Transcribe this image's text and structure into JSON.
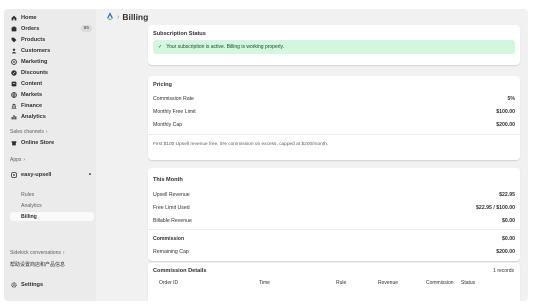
{
  "sidebar": {
    "items": [
      {
        "label": "Home",
        "icon": "home-icon"
      },
      {
        "label": "Orders",
        "icon": "orders-icon",
        "badge": "85"
      },
      {
        "label": "Products",
        "icon": "tag-icon"
      },
      {
        "label": "Customers",
        "icon": "person-icon"
      },
      {
        "label": "Marketing",
        "icon": "target-icon"
      },
      {
        "label": "Discounts",
        "icon": "discount-icon"
      },
      {
        "label": "Content",
        "icon": "content-icon"
      },
      {
        "label": "Markets",
        "icon": "globe-icon"
      },
      {
        "label": "Finance",
        "icon": "bank-icon"
      },
      {
        "label": "Analytics",
        "icon": "chart-icon"
      }
    ],
    "sales_channels_label": "Sales channels",
    "online_store": "Online Store",
    "apps_label": "Apps",
    "app_name": "easy-upsell",
    "app_sub": [
      "Rules",
      "Analytics",
      "Billing"
    ],
    "sidekick_label": "Sidekick conversations",
    "sidekick_item": "帮助设置商店和产品信息",
    "settings": "Settings"
  },
  "header": {
    "title": "Billing"
  },
  "subscription": {
    "title": "Subscription Status",
    "message": "Your subscription is active. Billing is working properly."
  },
  "pricing": {
    "title": "Pricing",
    "rows": [
      {
        "label": "Commission Rate",
        "value": "5%"
      },
      {
        "label": "Monthly Free Limit",
        "value": "$100.00"
      },
      {
        "label": "Monthly Cap",
        "value": "$200.00"
      }
    ],
    "note": "First $100 Upsell revenue free, 5% commission on excess, capped at $200/month."
  },
  "this_month": {
    "title": "This Month",
    "rows": [
      {
        "label": "Upsell Revenue",
        "value": "$22.95"
      },
      {
        "label": "Free Limit Used",
        "value": "$22.95 / $100.00"
      },
      {
        "label": "Billable Revenue",
        "value": "$0.00"
      }
    ],
    "rows2": [
      {
        "label": "Commission",
        "value": "$0.00"
      },
      {
        "label": "Remaining Cap",
        "value": "$200.00"
      }
    ]
  },
  "commission_details": {
    "title": "Commission Details",
    "count": "1 records",
    "columns": [
      "Order ID",
      "Time",
      "Rule",
      "Revenue",
      "Commission",
      "Status"
    ]
  },
  "colors": {
    "success_bg": "#d4f5de",
    "success_text": "#0c5132"
  }
}
